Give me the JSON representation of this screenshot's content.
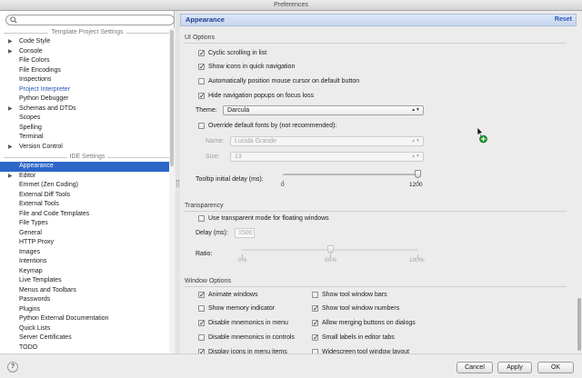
{
  "window": {
    "title": "Preferences"
  },
  "search": {
    "placeholder": ""
  },
  "tree": {
    "template_group": "Template Project Settings",
    "ide_group": "IDE Settings",
    "template_items": [
      {
        "label": "Code Style",
        "expandable": true
      },
      {
        "label": "Console",
        "expandable": true
      },
      {
        "label": "File Colors",
        "expandable": false
      },
      {
        "label": "File Encodings",
        "expandable": false
      },
      {
        "label": "Inspections",
        "expandable": false
      },
      {
        "label": "Project Interpreter",
        "expandable": false,
        "link": true
      },
      {
        "label": "Python Debugger",
        "expandable": false
      },
      {
        "label": "Schemas and DTDs",
        "expandable": true
      },
      {
        "label": "Scopes",
        "expandable": false
      },
      {
        "label": "Spelling",
        "expandable": false
      },
      {
        "label": "Terminal",
        "expandable": false
      },
      {
        "label": "Version Control",
        "expandable": true
      }
    ],
    "ide_items": [
      {
        "label": "Appearance",
        "expandable": false,
        "selected": true
      },
      {
        "label": "Editor",
        "expandable": true
      },
      {
        "label": "Emmet (Zen Coding)",
        "expandable": false
      },
      {
        "label": "External Diff Tools",
        "expandable": false
      },
      {
        "label": "External Tools",
        "expandable": false
      },
      {
        "label": "File and Code Templates",
        "expandable": false
      },
      {
        "label": "File Types",
        "expandable": false
      },
      {
        "label": "General",
        "expandable": false
      },
      {
        "label": "HTTP Proxy",
        "expandable": false
      },
      {
        "label": "Images",
        "expandable": false
      },
      {
        "label": "Intentions",
        "expandable": false
      },
      {
        "label": "Keymap",
        "expandable": false
      },
      {
        "label": "Live Templates",
        "expandable": false
      },
      {
        "label": "Menus and Toolbars",
        "expandable": false
      },
      {
        "label": "Passwords",
        "expandable": false
      },
      {
        "label": "Plugins",
        "expandable": false
      },
      {
        "label": "Python External Documentation",
        "expandable": false
      },
      {
        "label": "Quick Lists",
        "expandable": false
      },
      {
        "label": "Server Certificates",
        "expandable": false
      },
      {
        "label": "TODO",
        "expandable": false
      },
      {
        "label": "Updates",
        "expandable": false
      }
    ]
  },
  "panel": {
    "title": "Appearance",
    "reset_label": "Reset",
    "ui_options": {
      "title": "UI Options",
      "cyclic_scrolling": {
        "label": "Cyclic scrolling in list",
        "checked": true
      },
      "show_icons": {
        "label": "Show icons in quick navigation",
        "checked": true
      },
      "auto_position": {
        "label": "Automatically position mouse cursor on default button",
        "checked": false
      },
      "hide_popups": {
        "label": "Hide navigation popups on focus loss",
        "checked": true
      },
      "theme_label": "Theme:",
      "theme_value": "Darcula",
      "override_fonts": {
        "label": "Override default fonts by (not recommended):",
        "checked": false
      },
      "name_label": "Name:",
      "name_value": "Lucida Grande",
      "size_label": "Size:",
      "size_value": "13",
      "tooltip_label": "Tooltip initial delay (ms):",
      "tooltip_min": "0",
      "tooltip_max": "1200",
      "tooltip_value": 1200
    },
    "transparency": {
      "title": "Transparency",
      "use_transparent": {
        "label": "Use transparent mode for floating windows",
        "checked": false
      },
      "delay_label": "Delay (ms):",
      "delay_value": "1500",
      "ratio_label": "Ratio:",
      "ratio_ticks": [
        "0%",
        "50%",
        "100%"
      ],
      "ratio_value": 0.5
    },
    "window_options": {
      "title": "Window Options",
      "left": [
        {
          "label": "Animate windows",
          "checked": true
        },
        {
          "label": "Show memory indicator",
          "checked": false
        },
        {
          "label": "Disable mnemonics in menu",
          "checked": true
        },
        {
          "label": "Disable mnemonics in controls",
          "checked": false
        },
        {
          "label": "Display icons in menu items",
          "checked": true
        }
      ],
      "right": [
        {
          "label": "Show tool window bars",
          "checked": false
        },
        {
          "label": "Show tool window numbers",
          "checked": true
        },
        {
          "label": "Allow merging buttons on dialogs",
          "checked": true
        },
        {
          "label": "Small labels in editor tabs",
          "checked": true
        },
        {
          "label": "Widescreen tool window layout",
          "checked": false
        }
      ]
    }
  },
  "footer": {
    "help_label": "?",
    "cancel_label": "Cancel",
    "apply_label": "Apply",
    "ok_label": "OK"
  }
}
